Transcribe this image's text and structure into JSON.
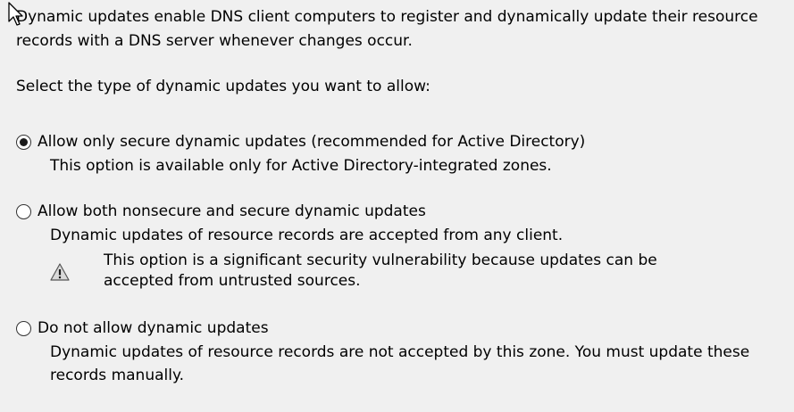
{
  "intro_text": "Dynamic updates enable DNS client computers to register and dynamically update their resource records with a DNS server whenever changes occur.",
  "prompt_text": "Select the type of dynamic updates you want to allow:",
  "options": [
    {
      "label": "Allow only secure dynamic updates (recommended for Active Directory)",
      "description": "This option is available only for Active Directory-integrated zones.",
      "selected": true
    },
    {
      "label": "Allow both nonsecure and secure dynamic updates",
      "description": "Dynamic updates of resource records are accepted from any client.",
      "selected": false,
      "warning": {
        "icon": "warning-triangle-icon",
        "text": "This option is a significant security vulnerability because updates can be accepted from untrusted sources."
      }
    },
    {
      "label": "Do not allow dynamic updates",
      "description": "Dynamic updates of resource records are not accepted by this zone. You must update these records manually.",
      "selected": false
    }
  ],
  "icons": {
    "cursor": "mouse-pointer-icon",
    "warning": "warning-triangle-icon"
  },
  "colors": {
    "background": "#f0f0f0",
    "text": "#000000",
    "warning_icon": "#d9d9d9"
  }
}
